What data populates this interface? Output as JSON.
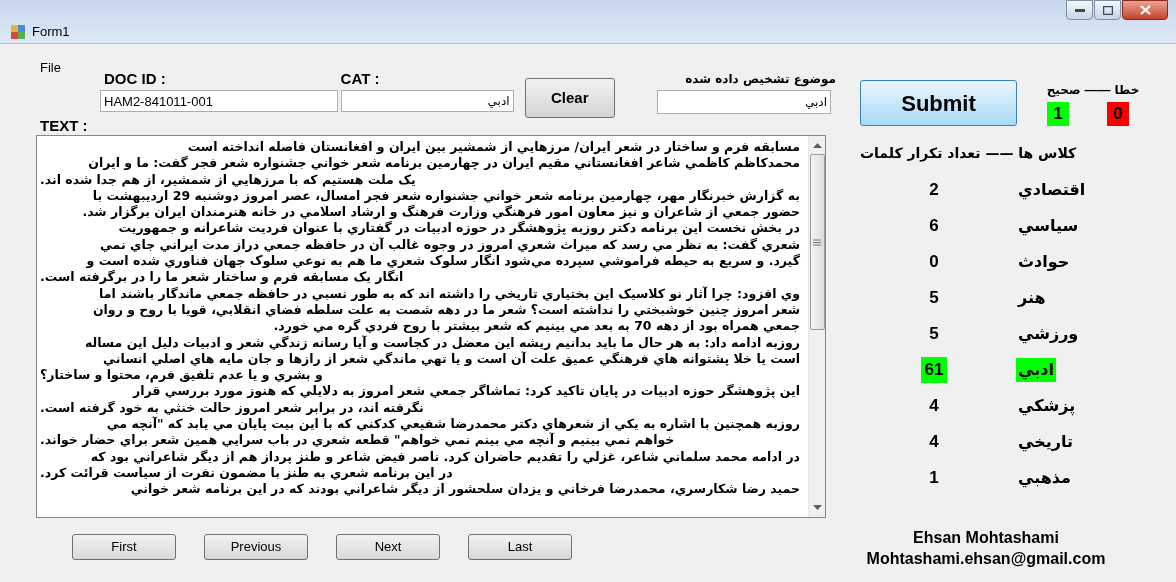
{
  "window": {
    "title": "Form1"
  },
  "menu": [
    "File"
  ],
  "doc_id": {
    "label": "DOC ID :",
    "value": "HAM2-841011-001"
  },
  "cat": {
    "label": "CAT :",
    "value": "ادبي"
  },
  "clear_button": "Clear",
  "detected_topic": {
    "label": "موضوع تشخيص داده شده",
    "value": "ادبي"
  },
  "submit_button": "Submit",
  "score": {
    "wrong_label": "خطا",
    "separator": "——",
    "correct_label": "صحيح",
    "correct": {
      "value": "1",
      "color": "#00ff00"
    },
    "wrong": {
      "value": "0",
      "color": "#ff0000"
    }
  },
  "text": {
    "label": "TEXT :",
    "lines": [
      {
        "kind": "paragraph",
        "text": "مسابقه فرم و ساختار در شعر ايران/ مرزهايي از شمشير بين ايران و افغانستان فاصله انداخته است"
      },
      {
        "kind": "paragraph",
        "text": "محمدكاظم كاظمي شاعر افغانستاني مقيم ايران در چهارمين برنامه شعر خواني جشنواره شعر فجر گفت: ما و ايران"
      },
      {
        "kind": "wrapped",
        "text": "يک ملت هستيم كه با مرزهايي از شمشير، از هم جدا شده اند."
      },
      {
        "kind": "paragraph",
        "text": "به گزارش خبرنگار مهر، چهارمين برنامه شعر خواني جشنواره شعر فجر امسال، عصر امروز دوشنبه 29 ارديبهشت با"
      },
      {
        "kind": "paragraph",
        "text": "حضور جمعي از شاعران و نيز معاون امور فرهنگي وزارت فرهنگ و ارشاد اسلامي در خانه هنرمندان ايران برگزار شد."
      },
      {
        "kind": "paragraph",
        "text": "در بخش نخست اين برنامه دكتر روزبه پژوهشگر در حوزه ادبيات در گفتاري با عنوان فرديت شاعرانه و جمهوريت"
      },
      {
        "kind": "paragraph",
        "text": "شعري گفت: به نظر مي رسد كه ميراث شعري امروز در وجوه غالب آن در حافظه جمعي دراز مدت ايراني جاي نمي"
      },
      {
        "kind": "paragraph",
        "text": "گيرد. و سريع به حيطه فراموشي سپرده مي‌شود انگار سلوک شعري ما هم به نوعي سلوک جهان فناوري شده است و"
      },
      {
        "kind": "wrapped",
        "text": "انگار يک مسابقه فرم و ساختار شعر ما را در برگرفته است."
      },
      {
        "kind": "paragraph",
        "text": "وي افزود: چرا آثار نو كلاسيک اين بختياري تاريخي را داشته اند كه به طور نسبي در حافظه جمعي ماندگار باشند اما"
      },
      {
        "kind": "paragraph",
        "text": "شعر امروز چنين خوشبختي را نداشته است؟ شعر ما در دهه شصت به علت سلطه فضاي انقلابي، قويا با روح و روان"
      },
      {
        "kind": "paragraph",
        "text": "جمعي همراه بود از دهه 70 به بعد مي بينيم كه شعر بيشتر با روح فردي گره مي خورد."
      },
      {
        "kind": "paragraph",
        "text": "روزبه ادامه داد: به هر حال ما بايد بدانيم ريشه اين معضل در كجاست و آيا رسانه زندگي شعر و ادبيات دليل اين مساله"
      },
      {
        "kind": "paragraph",
        "text": "است يا خلا پشتوانه هاي فرهنگي عميق علت آن است و يا تهي ماندگي شعر از رازها و جان مايه هاي اصلي انساني"
      },
      {
        "kind": "wrapped",
        "text": "و بشري و يا عدم تلفيق فرم، محتوا و ساختار؟"
      },
      {
        "kind": "paragraph",
        "text": "اين پژوهشگر حوزه ادبيات در پايان تاكيد كرد: تماشاگر جمعي شعر امروز به دلايلي كه هنوز مورد بررسي قرار"
      },
      {
        "kind": "wrapped",
        "text": "نگرفته اند، در برابر شعر امروز حالت خنثي به خود گرفته است."
      },
      {
        "kind": "paragraph",
        "text": "روزبه همچنين با اشاره به يكي از شعرهاي دكتر محمدرضا شفيعي كدكني كه با اين بيت پايان مي يابد كه \"آنچه مي"
      },
      {
        "kind": "wrapped",
        "text": "خواهم نمي بينيم و آنچه مي بينم نمي خواهم\" قطعه شعري در باب سرايي همين شعر براي حضار خواند."
      },
      {
        "kind": "paragraph",
        "text": "در ادامه محمد سلماني شاعر، غزلي را تقديم حاضران كرد. ناصر فيض شاعر و طنز پرداز هم از ديگر شاعراني بود كه"
      },
      {
        "kind": "wrapped",
        "text": "در اين برنامه شعري به طنز با مضمون نفرت از سياست قرائت كرد."
      },
      {
        "kind": "paragraph",
        "text": "حميد رضا شكارسري، محمدرضا فرخاني و يزدان سلحشور از ديگر شاعراني بودند كه در اين برنامه شعر خواني"
      }
    ]
  },
  "classes": {
    "header": "كلاس ها —— تعداد تكرار كلمات",
    "rows": [
      {
        "name": "اقتصادي",
        "count": "2",
        "selected": false
      },
      {
        "name": "سياسي",
        "count": "6",
        "selected": false
      },
      {
        "name": "حوادث",
        "count": "0",
        "selected": false
      },
      {
        "name": "هنر",
        "count": "5",
        "selected": false
      },
      {
        "name": "ورزشي",
        "count": "5",
        "selected": false
      },
      {
        "name": "ادبي",
        "count": "61",
        "selected": true
      },
      {
        "name": "پزشكي",
        "count": "4",
        "selected": false
      },
      {
        "name": "تاريخي",
        "count": "4",
        "selected": false
      },
      {
        "name": "مذهبي",
        "count": "1",
        "selected": false
      }
    ]
  },
  "navigation": {
    "first_button": "First",
    "previous_button": "Previous",
    "next_button": "Next",
    "last_button": "Last"
  },
  "author": {
    "name": "Ehsan Mohtashami",
    "email": "Mohtashami.ehsan@gmail.com"
  }
}
